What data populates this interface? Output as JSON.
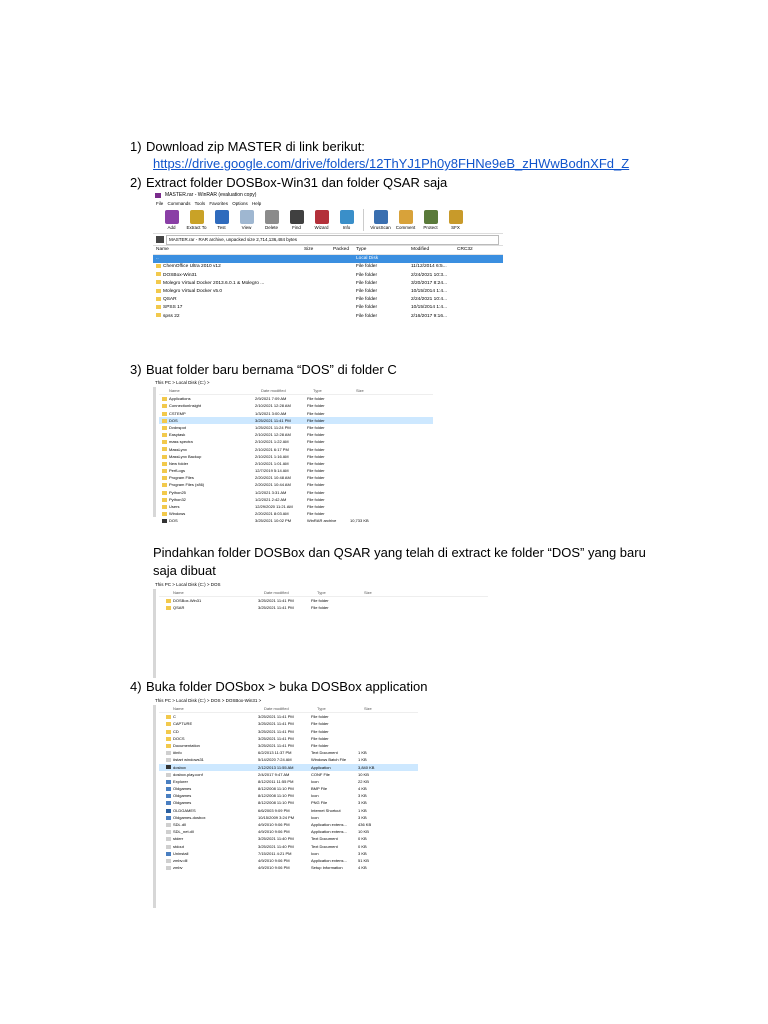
{
  "steps": [
    {
      "num": "1)",
      "text": "Download zip MASTER di link berikut:",
      "link": "https://drive.google.com/drive/folders/12ThYJ1Ph0y8FHNe9eB_zHWwBodnXFd_Z"
    },
    {
      "num": "2)",
      "text": "Extract folder DOSBox-Win31 dan folder QSAR saja"
    },
    {
      "num": "3)",
      "text": "Buat folder baru bernama “DOS” di folder C",
      "para_line1": "Pindahkan folder DOSBox dan QSAR yang telah di extract ke folder “DOS” yang baru",
      "para_line2": "saja dibuat"
    },
    {
      "num": "4)",
      "text": "Buka folder DOSbox > buka DOSBox application"
    }
  ],
  "winrar": {
    "title": "MASTER.rar - WinRAR (evaluation copy)",
    "menu": "File Commands Tools Favorites Options Help",
    "tools": [
      {
        "label": "Add",
        "color": "#8a3fa6"
      },
      {
        "label": "Extract To",
        "color": "#c9a227"
      },
      {
        "label": "Test",
        "color": "#2f6bbd"
      },
      {
        "label": "View",
        "color": "#9fb7d1"
      },
      {
        "label": "Delete",
        "color": "#8b8b8b"
      },
      {
        "label": "Find",
        "color": "#404040"
      },
      {
        "label": "Wizard",
        "color": "#b3303a"
      },
      {
        "label": "Info",
        "color": "#3a8fc9"
      },
      {
        "label": "VirusScan",
        "color": "#3a6fb0"
      },
      {
        "label": "Comment",
        "color": "#d8a23a"
      },
      {
        "label": "Protect",
        "color": "#5a7a3a"
      },
      {
        "label": "SFX",
        "color": "#c89a2a"
      }
    ],
    "address": "MASTER.rar - RAR archive, unpacked size 2,714,136,484 bytes",
    "columns": [
      "Name",
      "Size",
      "Packed",
      "Type",
      "Modified",
      "CRC32"
    ],
    "rows": [
      {
        "name": "..",
        "type": "Local Disk",
        "modified": ""
      },
      {
        "name": "ChemOffice Ultra 2010 v12",
        "type": "File folder",
        "modified": "11/12/2014 6:5..."
      },
      {
        "name": "DOSBox-Win31",
        "type": "File folder",
        "modified": "2/24/2021 10:3..."
      },
      {
        "name": "Molegro Virtual Docker 2013.6.0.1 & Molegro ...",
        "type": "File folder",
        "modified": "3/20/2017 8:24..."
      },
      {
        "name": "Molegro Virtual Docker v5.0",
        "type": "File folder",
        "modified": "10/15/2014 1:4..."
      },
      {
        "name": "QSAR",
        "type": "File folder",
        "modified": "2/24/2021 10:4..."
      },
      {
        "name": "SPSS 17",
        "type": "File folder",
        "modified": "10/15/2014 1:4..."
      },
      {
        "name": "spss 22",
        "type": "File folder",
        "modified": "2/16/2017 9:16..."
      }
    ]
  },
  "explorer1": {
    "crumb": "This PC > Local Disk (C:) >",
    "columns": [
      "Name",
      "Date modified",
      "Type",
      "Size"
    ],
    "rows": [
      {
        "name": "Applications",
        "date": "2/9/2021 7:09 AM",
        "type": "File folder",
        "size": "",
        "icon": "folder"
      },
      {
        "name": "ConnectionInsight",
        "date": "2/10/2021 12:28 AM",
        "type": "File folder",
        "size": "",
        "icon": "folder"
      },
      {
        "name": "CSTEMP",
        "date": "1/3/2021 3:00 AM",
        "type": "File folder",
        "size": "",
        "icon": "folder"
      },
      {
        "name": "DOS",
        "date": "3/25/2021 11:41 PM",
        "type": "File folder",
        "size": "",
        "icon": "folder"
      },
      {
        "name": "Dvdnspot",
        "date": "1/25/2021 11:24 PM",
        "type": "File folder",
        "size": "",
        "icon": "folder"
      },
      {
        "name": "Easytask",
        "date": "2/10/2021 12:28 AM",
        "type": "File folder",
        "size": "",
        "icon": "folder"
      },
      {
        "name": "mass spectra",
        "date": "2/10/2021 1:22 AM",
        "type": "File folder",
        "size": "",
        "icon": "folder"
      },
      {
        "name": "MassLynx",
        "date": "2/10/2021 6:17 PM",
        "type": "File folder",
        "size": "",
        "icon": "folder"
      },
      {
        "name": "MassLynx Backup",
        "date": "2/10/2021 1:16 AM",
        "type": "File folder",
        "size": "",
        "icon": "folder"
      },
      {
        "name": "New folder",
        "date": "2/10/2021 1:01 AM",
        "type": "File folder",
        "size": "",
        "icon": "folder"
      },
      {
        "name": "PerfLogs",
        "date": "12/7/2019 5:14 AM",
        "type": "File folder",
        "size": "",
        "icon": "folder"
      },
      {
        "name": "Program Files",
        "date": "2/20/2021 10:48 AM",
        "type": "File folder",
        "size": "",
        "icon": "folder"
      },
      {
        "name": "Program Files (x86)",
        "date": "2/20/2021 10:44 AM",
        "type": "File folder",
        "size": "",
        "icon": "folder"
      },
      {
        "name": "Python25",
        "date": "1/2/2021 3:31 AM",
        "type": "File folder",
        "size": "",
        "icon": "folder"
      },
      {
        "name": "Python32",
        "date": "1/2/2021 2:42 AM",
        "type": "File folder",
        "size": "",
        "icon": "folder"
      },
      {
        "name": "Users",
        "date": "12/29/2020 11:21 AM",
        "type": "File folder",
        "size": "",
        "icon": "folder"
      },
      {
        "name": "Windows",
        "date": "2/20/2021 8:03 AM",
        "type": "File folder",
        "size": "",
        "icon": "folder"
      },
      {
        "name": "DOS",
        "date": "3/25/2021 10:02 PM",
        "type": "WinRAR archive",
        "size": "10,733 KB",
        "icon": "app"
      }
    ]
  },
  "explorer2": {
    "crumb": "This PC > Local Disk (C:) > DOS",
    "columns": [
      "Name",
      "Date modified",
      "Type",
      "Size"
    ],
    "rows": [
      {
        "name": "DOSBox-Win31",
        "date": "3/25/2021 11:41 PM",
        "type": "File folder",
        "size": "",
        "icon": "folder"
      },
      {
        "name": "QSAR",
        "date": "3/25/2021 11:41 PM",
        "type": "File folder",
        "size": "",
        "icon": "folder"
      }
    ]
  },
  "explorer3": {
    "crumb": "This PC > Local Disk (C:) > DOS > DOSBox-Win31 >",
    "columns": [
      "Name",
      "Date modified",
      "Type",
      "Size"
    ],
    "rows": [
      {
        "name": "C",
        "date": "3/25/2021 11:41 PM",
        "type": "File folder",
        "size": "",
        "icon": "folder"
      },
      {
        "name": "CAPTURE",
        "date": "3/25/2021 11:41 PM",
        "type": "File folder",
        "size": "",
        "icon": "folder"
      },
      {
        "name": "CD",
        "date": "3/25/2021 11:41 PM",
        "type": "File folder",
        "size": "",
        "icon": "folder"
      },
      {
        "name": "DOCS",
        "date": "3/25/2021 11:41 PM",
        "type": "File folder",
        "size": "",
        "icon": "folder"
      },
      {
        "name": "Documentation",
        "date": "3/25/2021 11:41 PM",
        "type": "File folder",
        "size": "",
        "icon": "folder"
      },
      {
        "name": "#info",
        "date": "6/2/2013 11:37 PM",
        "type": "Text Document",
        "size": "1 KB",
        "icon": "txt"
      },
      {
        "name": "#start windows31",
        "date": "5/14/2020 7:24 AM",
        "type": "Windows Batch File",
        "size": "1 KB",
        "icon": "txt"
      },
      {
        "name": "dosbox",
        "date": "2/12/2013 11:55 AM",
        "type": "Application",
        "size": "3,840 KB",
        "icon": "app",
        "sel": true
      },
      {
        "name": "dosbox.play.conf",
        "date": "2/4/2017 9:47 AM",
        "type": "CONF File",
        "size": "10 KB",
        "icon": "txt"
      },
      {
        "name": "Explorer",
        "date": "8/12/2011 11:55 PM",
        "type": "Icon",
        "size": "22 KB",
        "icon": "img"
      },
      {
        "name": "Oldgames",
        "date": "8/12/2008 11:10 PM",
        "type": "BMP File",
        "size": "4 KB",
        "icon": "img"
      },
      {
        "name": "Oldgames",
        "date": "8/12/2008 11:10 PM",
        "type": "Icon",
        "size": "3 KB",
        "icon": "img"
      },
      {
        "name": "Oldgames",
        "date": "8/12/2008 11:10 PM",
        "type": "PNG File",
        "size": "3 KB",
        "icon": "img"
      },
      {
        "name": "OLDGAMES",
        "date": "6/6/2003 9:09 PM",
        "type": "Internet Shortcut",
        "size": "1 KB",
        "icon": "lnk"
      },
      {
        "name": "Oldgames-dosbox",
        "date": "10/15/2009 3:24 PM",
        "type": "Icon",
        "size": "3 KB",
        "icon": "img"
      },
      {
        "name": "SDL.dll",
        "date": "4/9/2010 9:06 PM",
        "type": "Application extens...",
        "size": "436 KB",
        "icon": "txt"
      },
      {
        "name": "SDL_net.dll",
        "date": "4/9/2010 9:06 PM",
        "type": "Application extens...",
        "size": "10 KB",
        "icon": "txt"
      },
      {
        "name": "stderr",
        "date": "3/25/2021 11:40 PM",
        "type": "Text Document",
        "size": "0 KB",
        "icon": "txt"
      },
      {
        "name": "stdout",
        "date": "3/25/2021 11:40 PM",
        "type": "Text Document",
        "size": "0 KB",
        "icon": "txt"
      },
      {
        "name": "Uninstall",
        "date": "7/15/2011 4:21 PM",
        "type": "Icon",
        "size": "3 KB",
        "icon": "img"
      },
      {
        "name": "zmbv.dll",
        "date": "4/9/2010 9:06 PM",
        "type": "Application extens...",
        "size": "51 KB",
        "icon": "txt"
      },
      {
        "name": "zmbv",
        "date": "4/9/2010 9:06 PM",
        "type": "Setup Information",
        "size": "4 KB",
        "icon": "txt"
      }
    ]
  },
  "colors": {
    "link": "#1155cc",
    "selection_winrar": "#3b8fe0",
    "selection_explorer": "#cde8ff",
    "folder": "#f2c94c"
  }
}
